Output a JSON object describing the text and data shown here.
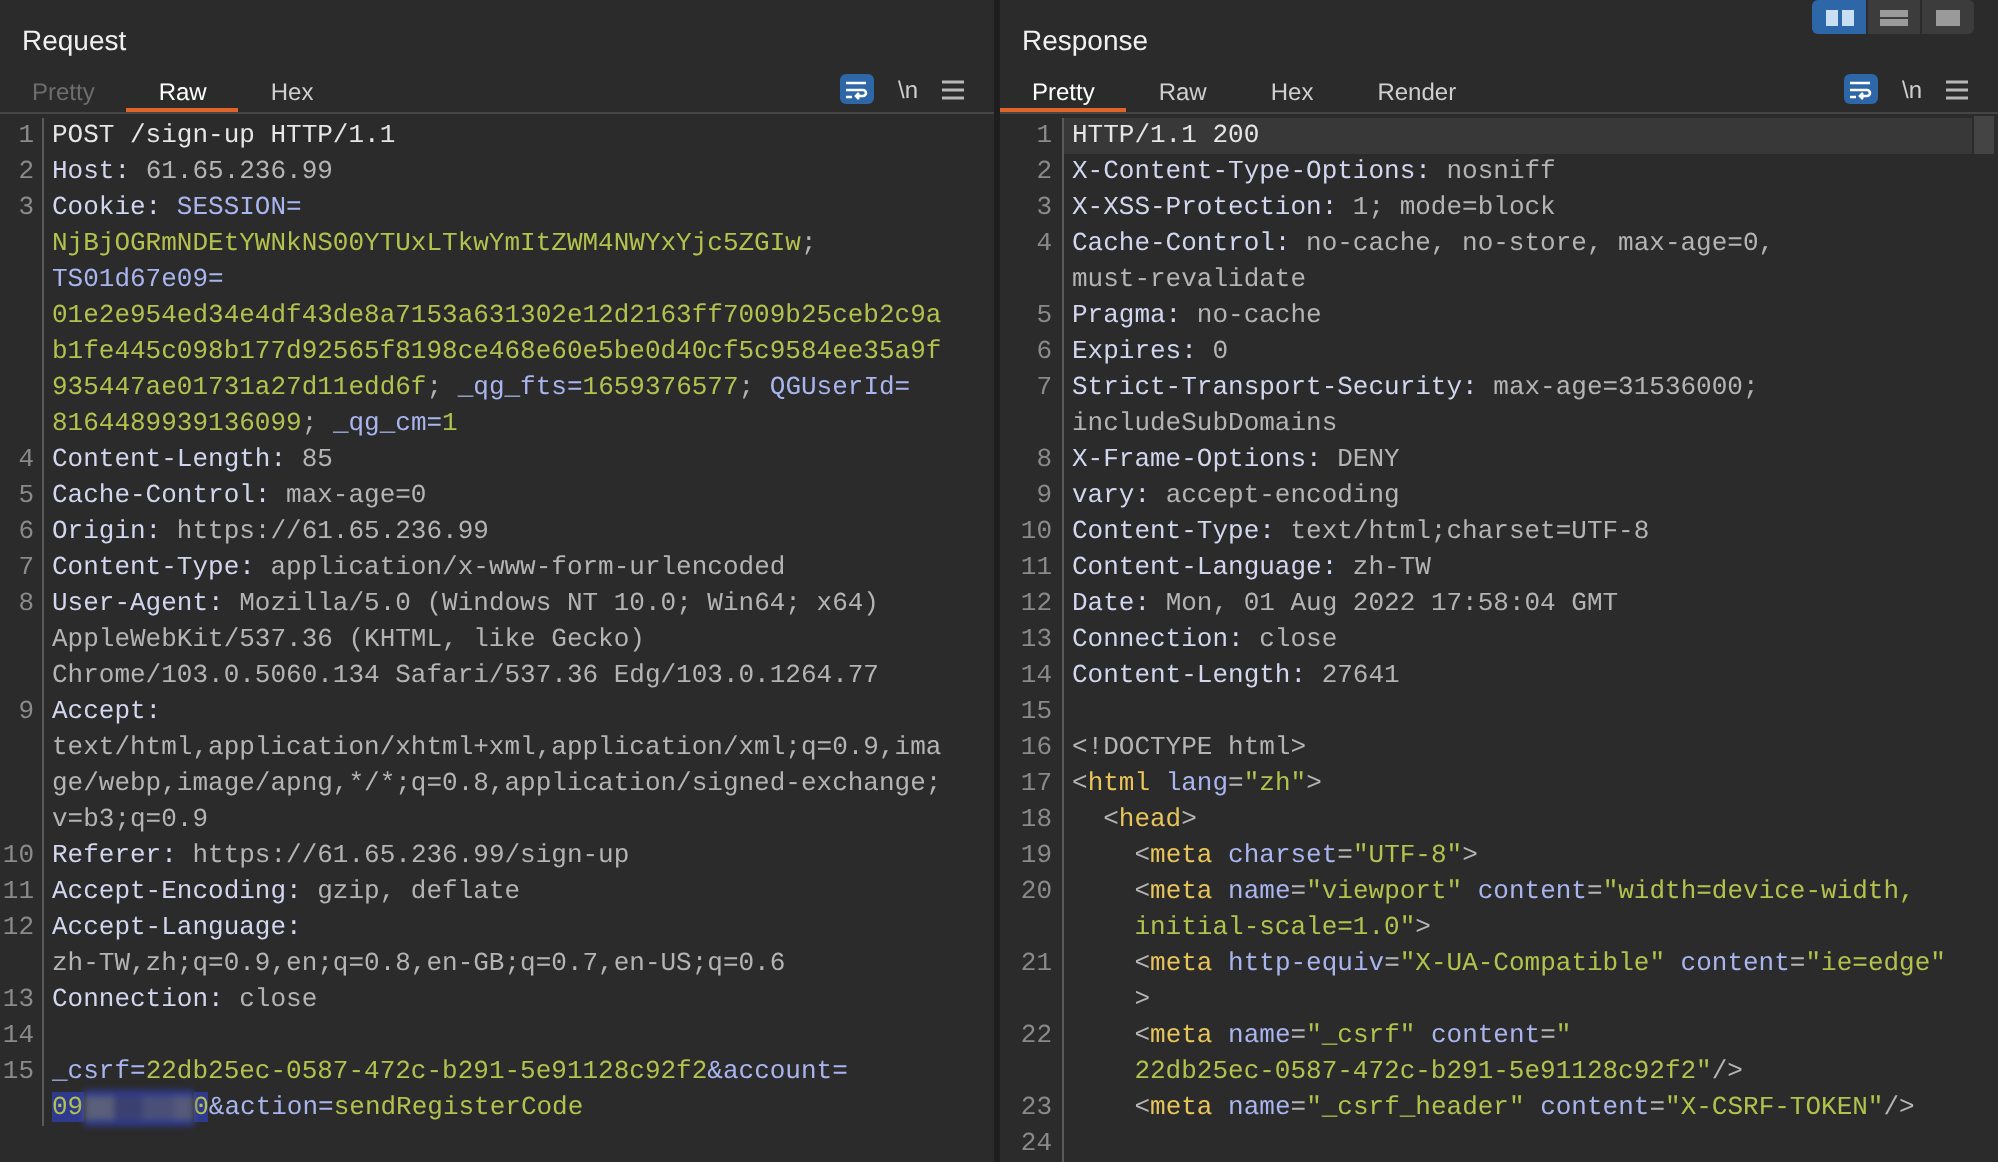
{
  "layout_buttons": [
    {
      "kind": "columns",
      "selected": true
    },
    {
      "kind": "rows",
      "selected": false
    },
    {
      "kind": "single",
      "selected": false
    }
  ],
  "panels": [
    {
      "title": "Request",
      "tabs": [
        {
          "label": "Pretty",
          "selected": false,
          "disabled": true
        },
        {
          "label": "Raw",
          "selected": true,
          "disabled": false
        },
        {
          "label": "Hex",
          "selected": false,
          "disabled": false
        }
      ],
      "toolbar": {
        "wrap_on": true,
        "newline_label": "\\n"
      },
      "lines": [
        {
          "number": "1",
          "rows": [
            {
              "segments": [
                {
                  "kind": "plain",
                  "text": "POST /sign-up HTTP/1.1"
                }
              ]
            }
          ]
        },
        {
          "number": "2",
          "rows": [
            {
              "segments": [
                {
                  "kind": "name",
                  "text": "Host:"
                },
                {
                  "kind": "value",
                  "text": " 61.65.236.99"
                }
              ]
            }
          ]
        },
        {
          "number": "3",
          "rows": [
            {
              "segments": [
                {
                  "kind": "name",
                  "text": "Cookie:"
                },
                {
                  "kind": "key",
                  "text": " SESSION="
                }
              ]
            },
            {
              "segments": [
                {
                  "kind": "str",
                  "text": "NjBjOGRmNDEtYWNkNS00YTUxLTkwYmItZWM4NWYxYjc5ZGIw"
                },
                {
                  "kind": "value",
                  "text": ";"
                }
              ]
            },
            {
              "segments": [
                {
                  "kind": "key",
                  "text": "TS01d67e09="
                }
              ]
            },
            {
              "segments": [
                {
                  "kind": "str",
                  "text": "01e2e954ed34e4df43de8a7153a631302e12d2163ff7009b25ceb2c9a"
                }
              ]
            },
            {
              "segments": [
                {
                  "kind": "str",
                  "text": "b1fe445c098b177d92565f8198ce468e60e5be0d40cf5c9584ee35a9f"
                }
              ]
            },
            {
              "segments": [
                {
                  "kind": "str",
                  "text": "935447ae01731a27d11edd6f"
                },
                {
                  "kind": "value",
                  "text": "; "
                },
                {
                  "kind": "key",
                  "text": "_qg_fts="
                },
                {
                  "kind": "str",
                  "text": "1659376577"
                },
                {
                  "kind": "value",
                  "text": "; "
                },
                {
                  "kind": "key",
                  "text": "QGUserId="
                }
              ]
            },
            {
              "segments": [
                {
                  "kind": "str",
                  "text": "8164489939136099"
                },
                {
                  "kind": "value",
                  "text": "; "
                },
                {
                  "kind": "key",
                  "text": "_qg_cm="
                },
                {
                  "kind": "str",
                  "text": "1"
                }
              ]
            }
          ]
        },
        {
          "number": "4",
          "rows": [
            {
              "segments": [
                {
                  "kind": "name",
                  "text": "Content-Length:"
                },
                {
                  "kind": "value",
                  "text": " 85"
                }
              ]
            }
          ]
        },
        {
          "number": "5",
          "rows": [
            {
              "segments": [
                {
                  "kind": "name",
                  "text": "Cache-Control:"
                },
                {
                  "kind": "value",
                  "text": " max-age=0"
                }
              ]
            }
          ]
        },
        {
          "number": "6",
          "rows": [
            {
              "segments": [
                {
                  "kind": "name",
                  "text": "Origin:"
                },
                {
                  "kind": "value",
                  "text": " https://61.65.236.99"
                }
              ]
            }
          ]
        },
        {
          "number": "7",
          "rows": [
            {
              "segments": [
                {
                  "kind": "name",
                  "text": "Content-Type:"
                },
                {
                  "kind": "value",
                  "text": " application/x-www-form-urlencoded"
                }
              ]
            }
          ]
        },
        {
          "number": "8",
          "rows": [
            {
              "segments": [
                {
                  "kind": "name",
                  "text": "User-Agent:"
                },
                {
                  "kind": "value",
                  "text": " Mozilla/5.0 (Windows NT 10.0; Win64; x64)"
                }
              ]
            },
            {
              "segments": [
                {
                  "kind": "value",
                  "text": "AppleWebKit/537.36 (KHTML, like Gecko)"
                }
              ]
            },
            {
              "segments": [
                {
                  "kind": "value",
                  "text": "Chrome/103.0.5060.134 Safari/537.36 Edg/103.0.1264.77"
                }
              ]
            }
          ]
        },
        {
          "number": "9",
          "rows": [
            {
              "segments": [
                {
                  "kind": "name",
                  "text": "Accept:"
                }
              ]
            },
            {
              "segments": [
                {
                  "kind": "value",
                  "text": "text/html,application/xhtml+xml,application/xml;q=0.9,ima"
                }
              ]
            },
            {
              "segments": [
                {
                  "kind": "value",
                  "text": "ge/webp,image/apng,*/*;q=0.8,application/signed-exchange;"
                }
              ]
            },
            {
              "segments": [
                {
                  "kind": "value",
                  "text": "v=b3;q=0.9"
                }
              ]
            }
          ]
        },
        {
          "number": "10",
          "rows": [
            {
              "segments": [
                {
                  "kind": "name",
                  "text": "Referer:"
                },
                {
                  "kind": "value",
                  "text": " https://61.65.236.99/sign-up"
                }
              ]
            }
          ]
        },
        {
          "number": "11",
          "rows": [
            {
              "segments": [
                {
                  "kind": "name",
                  "text": "Accept-Encoding:"
                },
                {
                  "kind": "value",
                  "text": " gzip, deflate"
                }
              ]
            }
          ]
        },
        {
          "number": "12",
          "rows": [
            {
              "segments": [
                {
                  "kind": "name",
                  "text": "Accept-Language:"
                }
              ]
            },
            {
              "segments": [
                {
                  "kind": "value",
                  "text": "zh-TW,zh;q=0.9,en;q=0.8,en-GB;q=0.7,en-US;q=0.6"
                }
              ]
            }
          ]
        },
        {
          "number": "13",
          "rows": [
            {
              "segments": [
                {
                  "kind": "name",
                  "text": "Connection:"
                },
                {
                  "kind": "value",
                  "text": " close"
                }
              ]
            }
          ]
        },
        {
          "number": "14"
        },
        {
          "number": "15",
          "rows": [
            {
              "segments": [
                {
                  "kind": "key",
                  "text": "_csrf="
                },
                {
                  "kind": "str",
                  "text": "22db25ec-0587-472c-b291-5e91128c92f2"
                },
                {
                  "kind": "key",
                  "text": "&account="
                }
              ]
            },
            {
              "segments": [
                {
                  "kind": "str",
                  "text": "09",
                  "selected": true
                },
                {
                  "kind": "redacted",
                  "selected": true
                },
                {
                  "kind": "str",
                  "text": "0",
                  "selected": true
                },
                {
                  "kind": "key",
                  "text": "&action=",
                  "selected": false
                },
                {
                  "kind": "str",
                  "text": "sendRegisterCode",
                  "selected": false
                }
              ]
            }
          ]
        }
      ]
    },
    {
      "title": "Response",
      "tabs": [
        {
          "label": "Pretty",
          "selected": true,
          "disabled": false
        },
        {
          "label": "Raw",
          "selected": false,
          "disabled": false
        },
        {
          "label": "Hex",
          "selected": false,
          "disabled": false
        },
        {
          "label": "Render",
          "selected": false,
          "disabled": false
        }
      ],
      "toolbar": {
        "wrap_on": true,
        "newline_label": "\\n"
      },
      "scrollbar": true,
      "lines": [
        {
          "number": "1",
          "current": true,
          "rows": [
            {
              "segments": [
                {
                  "kind": "plain",
                  "text": "HTTP/1.1 200"
                }
              ]
            }
          ]
        },
        {
          "number": "2",
          "current": false,
          "rows": [
            {
              "segments": [
                {
                  "kind": "name",
                  "text": "X-Content-Type-Options:"
                },
                {
                  "kind": "value",
                  "text": " nosniff"
                }
              ]
            }
          ]
        },
        {
          "number": "3",
          "current": false,
          "rows": [
            {
              "segments": [
                {
                  "kind": "name",
                  "text": "X-XSS-Protection:"
                },
                {
                  "kind": "value",
                  "text": " 1; mode=block"
                }
              ]
            }
          ]
        },
        {
          "number": "4",
          "current": false,
          "rows": [
            {
              "segments": [
                {
                  "kind": "name",
                  "text": "Cache-Control:"
                },
                {
                  "kind": "value",
                  "text": " no-cache, no-store, max-age=0,"
                }
              ]
            },
            {
              "segments": [
                {
                  "kind": "value",
                  "text": "must-revalidate"
                }
              ]
            }
          ]
        },
        {
          "number": "5",
          "current": false,
          "rows": [
            {
              "segments": [
                {
                  "kind": "name",
                  "text": "Pragma:"
                },
                {
                  "kind": "value",
                  "text": " no-cache"
                }
              ]
            }
          ]
        },
        {
          "number": "6",
          "current": false,
          "rows": [
            {
              "segments": [
                {
                  "kind": "name",
                  "text": "Expires:"
                },
                {
                  "kind": "value",
                  "text": " 0"
                }
              ]
            }
          ]
        },
        {
          "number": "7",
          "current": false,
          "rows": [
            {
              "segments": [
                {
                  "kind": "name",
                  "text": "Strict-Transport-Security:"
                },
                {
                  "kind": "value",
                  "text": " max-age=31536000;"
                }
              ]
            },
            {
              "segments": [
                {
                  "kind": "value",
                  "text": "includeSubDomains"
                }
              ]
            }
          ]
        },
        {
          "number": "8",
          "current": false,
          "rows": [
            {
              "segments": [
                {
                  "kind": "name",
                  "text": "X-Frame-Options:"
                },
                {
                  "kind": "value",
                  "text": " DENY"
                }
              ]
            }
          ]
        },
        {
          "number": "9",
          "current": false,
          "rows": [
            {
              "segments": [
                {
                  "kind": "name",
                  "text": "vary:"
                },
                {
                  "kind": "value",
                  "text": " accept-encoding"
                }
              ]
            }
          ]
        },
        {
          "number": "10",
          "current": false,
          "rows": [
            {
              "segments": [
                {
                  "kind": "name",
                  "text": "Content-Type:"
                },
                {
                  "kind": "value",
                  "text": " text/html;charset=UTF-8"
                }
              ]
            }
          ]
        },
        {
          "number": "11",
          "current": false,
          "rows": [
            {
              "segments": [
                {
                  "kind": "name",
                  "text": "Content-Language:"
                },
                {
                  "kind": "value",
                  "text": " zh-TW"
                }
              ]
            }
          ]
        },
        {
          "number": "12",
          "current": false,
          "rows": [
            {
              "segments": [
                {
                  "kind": "name",
                  "text": "Date:"
                },
                {
                  "kind": "value",
                  "text": " Mon, 01 Aug 2022 17:58:04 GMT"
                }
              ]
            }
          ]
        },
        {
          "number": "13",
          "current": false,
          "rows": [
            {
              "segments": [
                {
                  "kind": "name",
                  "text": "Connection:"
                },
                {
                  "kind": "value",
                  "text": " close"
                }
              ]
            }
          ]
        },
        {
          "number": "14",
          "current": false,
          "rows": [
            {
              "segments": [
                {
                  "kind": "name",
                  "text": "Content-Length:"
                },
                {
                  "kind": "value",
                  "text": " 27641"
                }
              ]
            }
          ]
        },
        {
          "number": "15",
          "current": false
        },
        {
          "number": "16",
          "current": false,
          "rows": [
            {
              "segments": [
                {
                  "kind": "value",
                  "text": "<!DOCTYPE html>"
                }
              ]
            }
          ]
        },
        {
          "number": "17",
          "current": false,
          "rows": [
            {
              "segments": [
                {
                  "kind": "value",
                  "text": "<"
                },
                {
                  "kind": "tag",
                  "text": "html"
                },
                {
                  "kind": "key",
                  "text": " lang"
                },
                {
                  "kind": "value",
                  "text": "="
                },
                {
                  "kind": "str",
                  "text": "\"zh\""
                },
                {
                  "kind": "value",
                  "text": ">"
                }
              ]
            }
          ]
        },
        {
          "number": "18",
          "current": false,
          "rows": [
            {
              "segments": [
                {
                  "kind": "value",
                  "text": "  <"
                },
                {
                  "kind": "tag",
                  "text": "head"
                },
                {
                  "kind": "value",
                  "text": ">"
                }
              ]
            }
          ]
        },
        {
          "number": "19",
          "current": false,
          "rows": [
            {
              "segments": [
                {
                  "kind": "value",
                  "text": "    <"
                },
                {
                  "kind": "tag",
                  "text": "meta"
                },
                {
                  "kind": "key",
                  "text": " charset"
                },
                {
                  "kind": "value",
                  "text": "="
                },
                {
                  "kind": "str",
                  "text": "\"UTF-8\""
                },
                {
                  "kind": "value",
                  "text": ">"
                }
              ]
            }
          ]
        },
        {
          "number": "20",
          "current": false,
          "rows": [
            {
              "segments": [
                {
                  "kind": "value",
                  "text": "    <"
                },
                {
                  "kind": "tag",
                  "text": "meta"
                },
                {
                  "kind": "key",
                  "text": " name"
                },
                {
                  "kind": "value",
                  "text": "="
                },
                {
                  "kind": "str",
                  "text": "\"viewport\""
                },
                {
                  "kind": "key",
                  "text": " content"
                },
                {
                  "kind": "value",
                  "text": "="
                },
                {
                  "kind": "str",
                  "text": "\"width=device-width,"
                }
              ]
            },
            {
              "segments": [
                {
                  "kind": "str",
                  "text": "    initial-scale=1.0\""
                },
                {
                  "kind": "value",
                  "text": ">"
                }
              ]
            }
          ]
        },
        {
          "number": "21",
          "current": false,
          "rows": [
            {
              "segments": [
                {
                  "kind": "value",
                  "text": "    <"
                },
                {
                  "kind": "tag",
                  "text": "meta"
                },
                {
                  "kind": "key",
                  "text": " http-equiv"
                },
                {
                  "kind": "value",
                  "text": "="
                },
                {
                  "kind": "str",
                  "text": "\"X-UA-Compatible\""
                },
                {
                  "kind": "key",
                  "text": " content"
                },
                {
                  "kind": "value",
                  "text": "="
                },
                {
                  "kind": "str",
                  "text": "\"ie=edge\""
                }
              ]
            },
            {
              "segments": [
                {
                  "kind": "value",
                  "text": "    >"
                }
              ]
            }
          ]
        },
        {
          "number": "22",
          "current": false,
          "rows": [
            {
              "segments": [
                {
                  "kind": "value",
                  "text": "    <"
                },
                {
                  "kind": "tag",
                  "text": "meta"
                },
                {
                  "kind": "key",
                  "text": " name"
                },
                {
                  "kind": "value",
                  "text": "="
                },
                {
                  "kind": "str",
                  "text": "\"_csrf\""
                },
                {
                  "kind": "key",
                  "text": " content"
                },
                {
                  "kind": "value",
                  "text": "="
                },
                {
                  "kind": "str",
                  "text": "\""
                }
              ]
            },
            {
              "segments": [
                {
                  "kind": "str",
                  "text": "    22db25ec-0587-472c-b291-5e91128c92f2\""
                },
                {
                  "kind": "value",
                  "text": "/>"
                }
              ]
            }
          ]
        },
        {
          "number": "23",
          "current": false,
          "rows": [
            {
              "segments": [
                {
                  "kind": "value",
                  "text": "    <"
                },
                {
                  "kind": "tag",
                  "text": "meta"
                },
                {
                  "kind": "key",
                  "text": " name"
                },
                {
                  "kind": "value",
                  "text": "="
                },
                {
                  "kind": "str",
                  "text": "\"_csrf_header\""
                },
                {
                  "kind": "key",
                  "text": " content"
                },
                {
                  "kind": "value",
                  "text": "="
                },
                {
                  "kind": "str",
                  "text": "\"X-CSRF-TOKEN\""
                },
                {
                  "kind": "value",
                  "text": "/>"
                }
              ]
            }
          ]
        },
        {
          "number": "24",
          "current": false
        }
      ]
    }
  ]
}
